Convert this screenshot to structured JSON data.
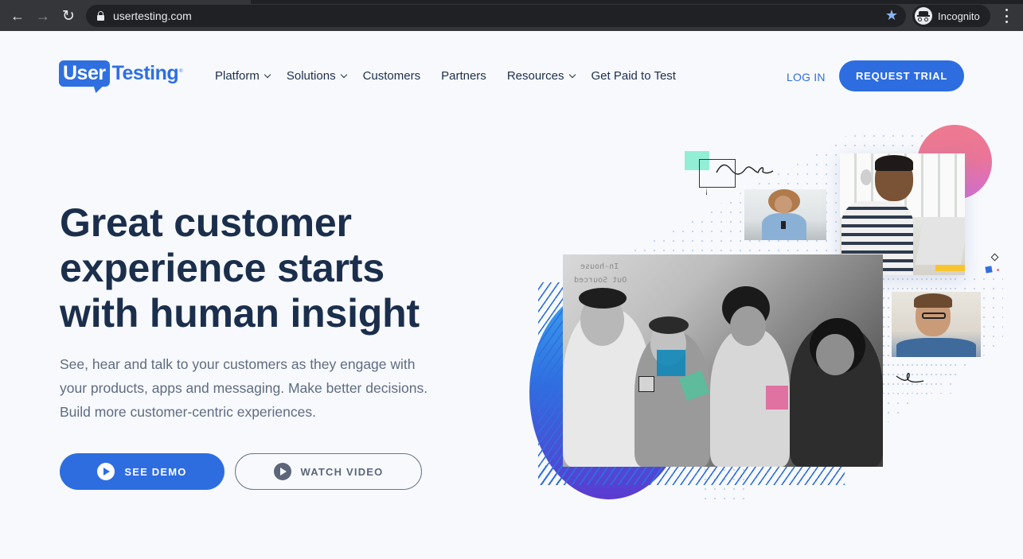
{
  "browser": {
    "url": "usertesting.com",
    "profile_label": "Incognito",
    "icons": {
      "back": "arrow-left-icon",
      "forward": "arrow-right-icon",
      "reload": "reload-icon",
      "lock": "lock-icon",
      "bookmark": "star-icon",
      "incognito": "incognito-icon",
      "menu": "kebab-menu-icon"
    },
    "glyphs": {
      "back": "←",
      "forward": "→",
      "reload": "↻",
      "star": "★"
    }
  },
  "header": {
    "logo": {
      "part1": "User",
      "part2": "Testing",
      "registered": "®"
    },
    "nav": [
      {
        "label": "Platform",
        "has_dropdown": true
      },
      {
        "label": "Solutions",
        "has_dropdown": true
      },
      {
        "label": "Customers",
        "has_dropdown": false
      },
      {
        "label": "Partners",
        "has_dropdown": false
      },
      {
        "label": "Resources",
        "has_dropdown": true
      },
      {
        "label": "Get Paid to Test",
        "has_dropdown": false
      }
    ],
    "login_label": "LOG IN",
    "cta_label": "REQUEST TRIAL"
  },
  "hero": {
    "headline_lines": [
      "Great customer",
      "experience starts",
      "with human insight"
    ],
    "subtext": "See, hear and talk to your customers as they engage with your products, apps and messaging. Make better decisions. Build more customer-centric experiences.",
    "primary_button": "SEE DEMO",
    "secondary_button": "WATCH VIDEO"
  },
  "illustration": {
    "main_photo_overlay_text": [
      "In-house",
      "Out Sourced"
    ]
  },
  "colors": {
    "brand_blue": "#2d6de0",
    "headline_navy": "#1b2f4c",
    "body_gray": "#5f6c80",
    "page_bg": "#f7f9fd",
    "chrome_bg": "#35363a",
    "accent_pink": "#ea7598",
    "accent_teal": "#92efd6"
  }
}
